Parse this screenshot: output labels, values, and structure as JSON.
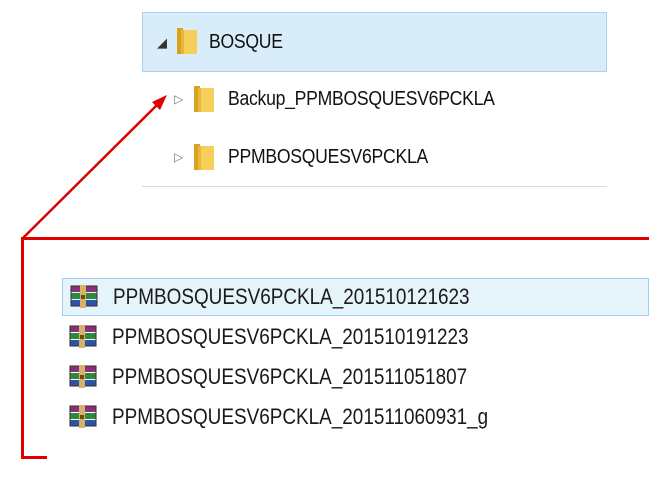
{
  "tree": {
    "items": [
      {
        "label": "BOSQUE",
        "expanded": true,
        "selected": true,
        "icon": "folder-icon"
      },
      {
        "label": "Backup_PPMBOSQUESV6PCKLA",
        "expanded": false,
        "selected": false,
        "icon": "folder-icon"
      },
      {
        "label": "PPMBOSQUESV6PCKLA",
        "expanded": false,
        "selected": false,
        "icon": "folder-icon"
      }
    ]
  },
  "files": {
    "items": [
      {
        "name": "PPMBOSQUESV6PCKLA_201510121623",
        "icon": "winrar-archive-icon",
        "selected": true
      },
      {
        "name": "PPMBOSQUESV6PCKLA_201510191223",
        "icon": "winrar-archive-icon",
        "selected": false
      },
      {
        "name": "PPMBOSQUESV6PCKLA_201511051807",
        "icon": "winrar-archive-icon",
        "selected": false
      },
      {
        "name": "PPMBOSQUESV6PCKLA_201511060931_g",
        "icon": "winrar-archive-icon",
        "selected": false
      }
    ]
  },
  "annotation": {
    "color": "#e00000",
    "description_visible": false
  },
  "colors": {
    "selection_fill": "#d9ecf9",
    "selection_border": "#a7d3f0",
    "folder_yellow": "#f5c94a",
    "annotation_red": "#e00000"
  }
}
